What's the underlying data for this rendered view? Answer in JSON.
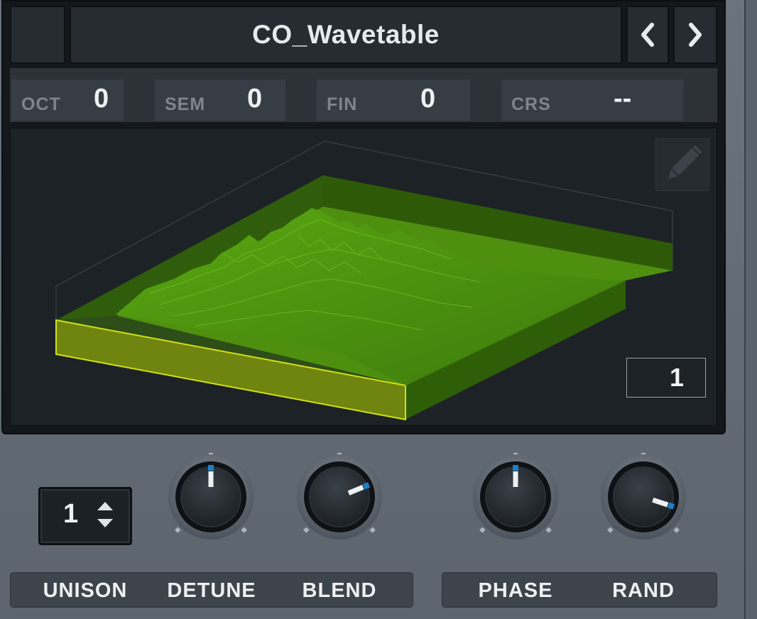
{
  "header": {
    "preset_name": "CO_Wavetable",
    "prev_icon": "chevron-left-icon",
    "next_icon": "chevron-right-icon"
  },
  "pitch": {
    "oct": {
      "label": "OCT",
      "value": "0"
    },
    "sem": {
      "label": "SEM",
      "value": "0"
    },
    "fin": {
      "label": "FIN",
      "value": "0"
    },
    "crs": {
      "label": "CRS",
      "value": "--"
    }
  },
  "wavetable_view": {
    "frame_number": "1",
    "edit_icon": "pencil-icon",
    "colors": {
      "terrain": "#4e9a0a",
      "highlight": "#d3e014"
    }
  },
  "controls": {
    "unison": {
      "label": "UNISON",
      "value": "1"
    },
    "knobs": [
      {
        "id": "detune",
        "label": "DETUNE",
        "level": 0.5
      },
      {
        "id": "blend",
        "label": "BLEND",
        "level": 0.75
      },
      {
        "id": "phase",
        "label": "PHASE",
        "level": 0.5
      },
      {
        "id": "rand",
        "label": "RAND",
        "level": 0.9
      }
    ],
    "accent_color": "#1f7fc8"
  }
}
